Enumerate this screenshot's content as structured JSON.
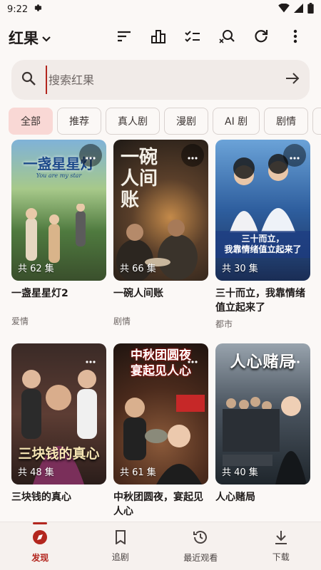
{
  "status": {
    "time": "9:22"
  },
  "app": {
    "title": "红果"
  },
  "search": {
    "placeholder": "搜索红果"
  },
  "chips": [
    "全部",
    "推荐",
    "真人剧",
    "漫剧",
    "AI 剧",
    "剧情"
  ],
  "cards": [
    {
      "title": "一盏星星灯2",
      "episodes": "共 62 集",
      "tag": "爱情",
      "poster_text": "一盏星星灯",
      "poster_sub": "You are my star",
      "accent": "#5a7d5a"
    },
    {
      "title": "一碗人间账",
      "episodes": "共 66 集",
      "tag": "剧情",
      "poster_text": "一碗人间账",
      "accent": "#3b3028"
    },
    {
      "title": "三十而立，我靠情绪值立起来了",
      "episodes": "共 30 集",
      "tag": "都市",
      "poster_text": "三十而立，\n我靠情绪值立起来了",
      "accent": "#3a5fa8"
    },
    {
      "title": "三块钱的真心",
      "episodes": "共 48 集",
      "tag": "",
      "poster_text": "三块钱的真心",
      "accent": "#5a3a30"
    },
    {
      "title": "中秋团圆夜，宴起见人心",
      "episodes": "共 61 集",
      "tag": "",
      "poster_text": "中秋团圆夜\n宴起见人心",
      "accent": "#4a2a1c"
    },
    {
      "title": "人心赌局",
      "episodes": "共 40 集",
      "tag": "",
      "poster_text": "人心赌局",
      "accent": "#2a3a48"
    }
  ],
  "nav": [
    {
      "label": "发现",
      "icon": "compass-icon",
      "active": true
    },
    {
      "label": "追剧",
      "icon": "bookmark-icon",
      "active": false
    },
    {
      "label": "最近观看",
      "icon": "history-icon",
      "active": false
    },
    {
      "label": "下载",
      "icon": "download-icon",
      "active": false
    }
  ],
  "colors": {
    "accent": "#b3261e",
    "chip_active": "#f9d8d5",
    "background": "#fbf8f6"
  }
}
